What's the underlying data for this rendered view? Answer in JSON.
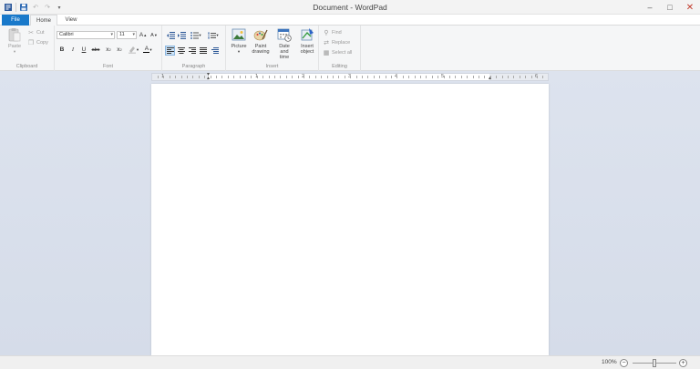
{
  "window": {
    "title": "Document - WordPad"
  },
  "tabs": [
    {
      "label": "File"
    },
    {
      "label": "Home"
    },
    {
      "label": "View"
    }
  ],
  "clipboard": {
    "label": "Clipboard",
    "paste_label": "Paste",
    "cut_label": "Cut",
    "copy_label": "Copy"
  },
  "font": {
    "label": "Font",
    "family": "Calibri",
    "size": "11"
  },
  "paragraph": {
    "label": "Paragraph"
  },
  "insert": {
    "label": "Insert",
    "picture_label": "Picture",
    "paint_line1": "Paint",
    "paint_line2": "drawing",
    "datetime_line1": "Date and",
    "datetime_line2": "time",
    "object_line1": "Insert",
    "object_line2": "object"
  },
  "editing": {
    "label": "Editing",
    "find_label": "Find",
    "replace_label": "Replace",
    "selectall_label": "Select all"
  },
  "ruler": {
    "numbers": [
      "1",
      "1",
      "2",
      "3",
      "4",
      "5",
      "6"
    ]
  },
  "status": {
    "zoom": "100%",
    "zoom_level": 0.5
  },
  "colors": {
    "file_tab": "#1979ca",
    "close_x": "#c0392b",
    "workspace": "#d9e0ec"
  }
}
